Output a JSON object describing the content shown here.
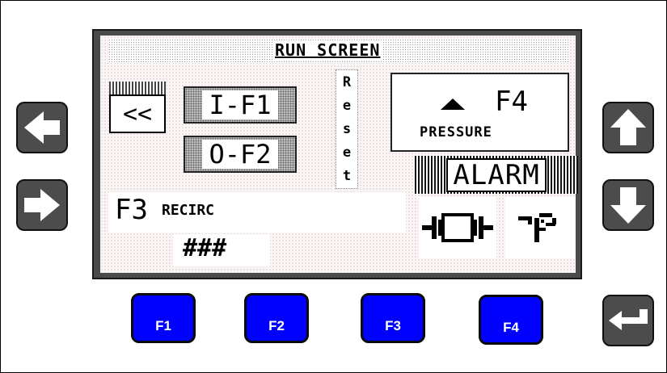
{
  "screen": {
    "title": "RUN SCREEN",
    "back": "<<",
    "inlet": "I-F1",
    "outlet": "O-F2",
    "reset_letters": [
      "R",
      "e",
      "s",
      "e",
      "t"
    ],
    "pressure": {
      "key": "F4",
      "label": "PRESSURE",
      "icon": "arrow-up-triangle-icon"
    },
    "alarm": "ALARM",
    "recirc": {
      "key": "F3",
      "label": "RECIRC"
    },
    "value": "###",
    "pump_icon": "pump-icon",
    "valve_icon": "valve-icon"
  },
  "keys": {
    "left": "arrow-left-icon",
    "right": "arrow-right-icon",
    "up": "arrow-up-icon",
    "down": "arrow-down-icon",
    "enter": "enter-icon",
    "f1": "F1",
    "f2": "F2",
    "f3": "F3",
    "f4": "F4"
  },
  "colors": {
    "function_key": "#0000ff",
    "nav_key": "#4c4c4c",
    "bezel": "#4a4a4a"
  }
}
